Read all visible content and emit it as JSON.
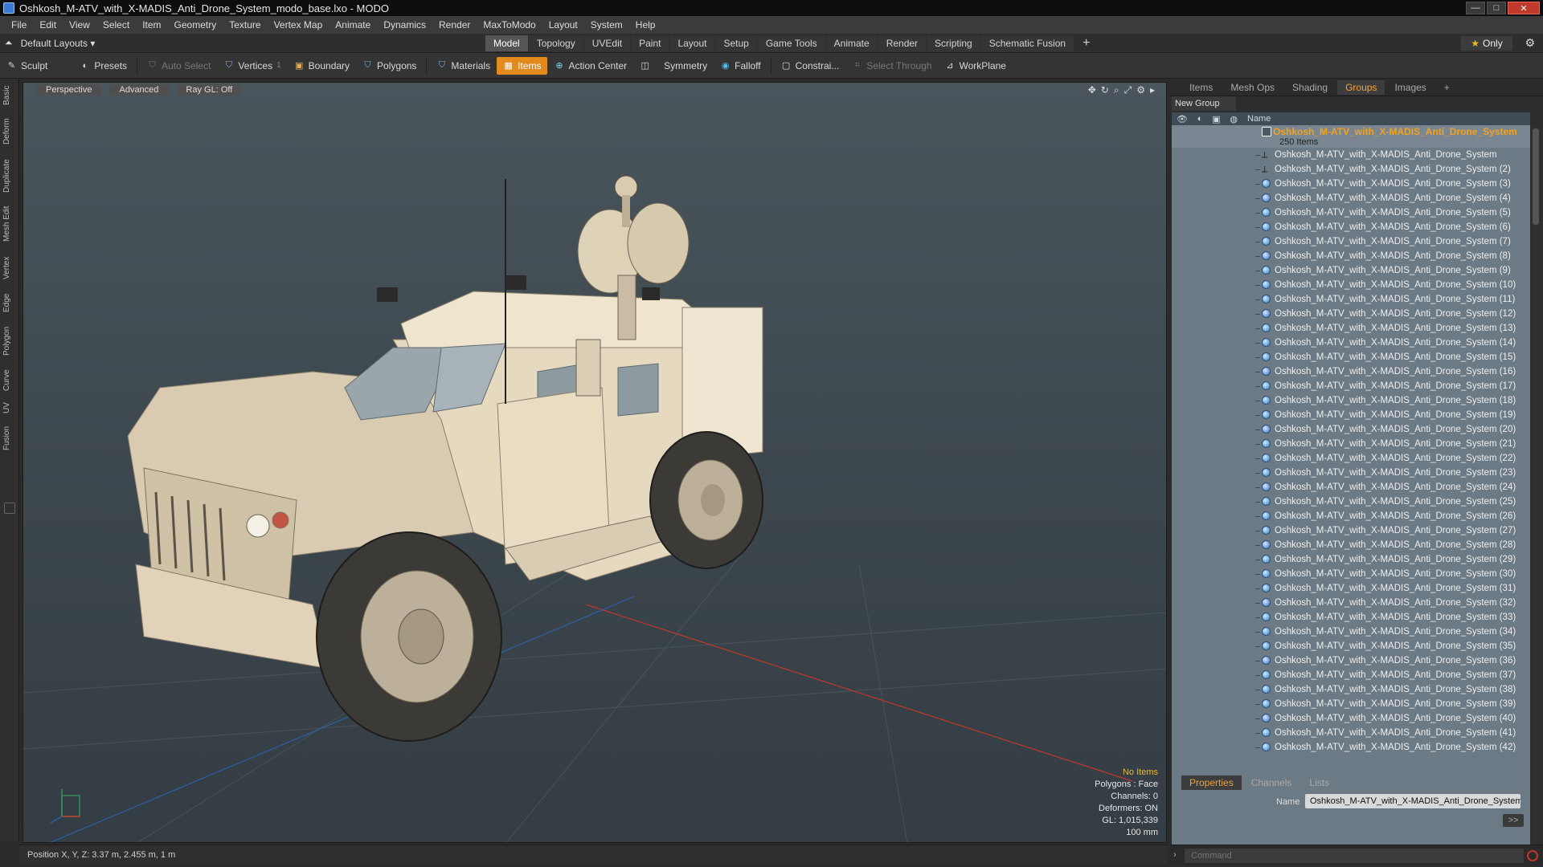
{
  "window": {
    "title": "Oshkosh_M-ATV_with_X-MADIS_Anti_Drone_System_modo_base.lxo - MODO",
    "min": "—",
    "max": "□",
    "close": "✕"
  },
  "menu": [
    "File",
    "Edit",
    "View",
    "Select",
    "Item",
    "Geometry",
    "Texture",
    "Vertex Map",
    "Animate",
    "Dynamics",
    "Render",
    "MaxToModo",
    "Layout",
    "System",
    "Help"
  ],
  "layouts": {
    "preset": "Default Layouts ▾",
    "tabs": [
      "Model",
      "Topology",
      "UVEdit",
      "Paint",
      "Layout",
      "Setup",
      "Game Tools",
      "Animate",
      "Render",
      "Scripting",
      "Schematic Fusion"
    ],
    "active": "Model",
    "add": "+",
    "only": "Only"
  },
  "toolbar": {
    "sculpt": "Sculpt",
    "presets": "Presets",
    "auto_select": "Auto Select",
    "vertices": "Vertices",
    "vertices_count": "1",
    "boundary": "Boundary",
    "polygons": "Polygons",
    "materials": "Materials",
    "items": "Items",
    "action_center": "Action Center",
    "symmetry": "Symmetry",
    "falloff": "Falloff",
    "constraints": "Constrai...",
    "select_through": "Select Through",
    "workplane": "WorkPlane"
  },
  "left_tabs": [
    "Basic",
    "Deform",
    "Duplicate",
    "Mesh Edit",
    "Vertex",
    "Edge",
    "Polygon",
    "Curve",
    "UV",
    "Fusion"
  ],
  "viewport": {
    "view_mode": "Perspective",
    "shading": "Advanced",
    "raygl": "Ray GL: Off",
    "info": {
      "selection": "No Items",
      "polygons": "Polygons : Face",
      "channels": "Channels: 0",
      "deformers": "Deformers: ON",
      "gl": "GL: 1,015,339",
      "unit": "100 mm"
    }
  },
  "status": {
    "position": "Position X, Y, Z:  3.37 m, 2.455 m, 1 m"
  },
  "right_panel": {
    "tabs": [
      "Items",
      "Mesh Ops",
      "Shading",
      "Groups",
      "Images"
    ],
    "active_tab": "Groups",
    "add": "+",
    "new_group": "New Group",
    "column_name": "Name",
    "group_name": "Oshkosh_M-ATV_with_X-MADIS_Anti_Drone_System",
    "group_count": "250 Items",
    "items": [
      "Oshkosh_M-ATV_with_X-MADIS_Anti_Drone_System",
      "Oshkosh_M-ATV_with_X-MADIS_Anti_Drone_System (2)",
      "Oshkosh_M-ATV_with_X-MADIS_Anti_Drone_System (3)",
      "Oshkosh_M-ATV_with_X-MADIS_Anti_Drone_System (4)",
      "Oshkosh_M-ATV_with_X-MADIS_Anti_Drone_System (5)",
      "Oshkosh_M-ATV_with_X-MADIS_Anti_Drone_System (6)",
      "Oshkosh_M-ATV_with_X-MADIS_Anti_Drone_System (7)",
      "Oshkosh_M-ATV_with_X-MADIS_Anti_Drone_System (8)",
      "Oshkosh_M-ATV_with_X-MADIS_Anti_Drone_System (9)",
      "Oshkosh_M-ATV_with_X-MADIS_Anti_Drone_System (10)",
      "Oshkosh_M-ATV_with_X-MADIS_Anti_Drone_System (11)",
      "Oshkosh_M-ATV_with_X-MADIS_Anti_Drone_System (12)",
      "Oshkosh_M-ATV_with_X-MADIS_Anti_Drone_System (13)",
      "Oshkosh_M-ATV_with_X-MADIS_Anti_Drone_System (14)",
      "Oshkosh_M-ATV_with_X-MADIS_Anti_Drone_System (15)",
      "Oshkosh_M-ATV_with_X-MADIS_Anti_Drone_System (16)",
      "Oshkosh_M-ATV_with_X-MADIS_Anti_Drone_System (17)",
      "Oshkosh_M-ATV_with_X-MADIS_Anti_Drone_System (18)",
      "Oshkosh_M-ATV_with_X-MADIS_Anti_Drone_System (19)",
      "Oshkosh_M-ATV_with_X-MADIS_Anti_Drone_System (20)",
      "Oshkosh_M-ATV_with_X-MADIS_Anti_Drone_System (21)",
      "Oshkosh_M-ATV_with_X-MADIS_Anti_Drone_System (22)",
      "Oshkosh_M-ATV_with_X-MADIS_Anti_Drone_System (23)",
      "Oshkosh_M-ATV_with_X-MADIS_Anti_Drone_System (24)",
      "Oshkosh_M-ATV_with_X-MADIS_Anti_Drone_System (25)",
      "Oshkosh_M-ATV_with_X-MADIS_Anti_Drone_System (26)",
      "Oshkosh_M-ATV_with_X-MADIS_Anti_Drone_System (27)",
      "Oshkosh_M-ATV_with_X-MADIS_Anti_Drone_System (28)",
      "Oshkosh_M-ATV_with_X-MADIS_Anti_Drone_System (29)",
      "Oshkosh_M-ATV_with_X-MADIS_Anti_Drone_System (30)",
      "Oshkosh_M-ATV_with_X-MADIS_Anti_Drone_System (31)",
      "Oshkosh_M-ATV_with_X-MADIS_Anti_Drone_System (32)",
      "Oshkosh_M-ATV_with_X-MADIS_Anti_Drone_System (33)",
      "Oshkosh_M-ATV_with_X-MADIS_Anti_Drone_System (34)",
      "Oshkosh_M-ATV_with_X-MADIS_Anti_Drone_System (35)",
      "Oshkosh_M-ATV_with_X-MADIS_Anti_Drone_System (36)",
      "Oshkosh_M-ATV_with_X-MADIS_Anti_Drone_System (37)",
      "Oshkosh_M-ATV_with_X-MADIS_Anti_Drone_System (38)",
      "Oshkosh_M-ATV_with_X-MADIS_Anti_Drone_System (39)",
      "Oshkosh_M-ATV_with_X-MADIS_Anti_Drone_System (40)",
      "Oshkosh_M-ATV_with_X-MADIS_Anti_Drone_System (41)",
      "Oshkosh_M-ATV_with_X-MADIS_Anti_Drone_System (42)"
    ],
    "bottom_tabs": [
      "Properties",
      "Channels",
      "Lists"
    ],
    "bottom_active": "Properties",
    "name_label": "Name",
    "name_value": "Oshkosh_M-ATV_with_X-MADIS_Anti_Drone_System (",
    "expand": ">>",
    "command_placeholder": "Command"
  },
  "colors": {
    "accent": "#e38a1d",
    "group_title": "#f3a21d",
    "list_bg": "#6c7a85"
  }
}
